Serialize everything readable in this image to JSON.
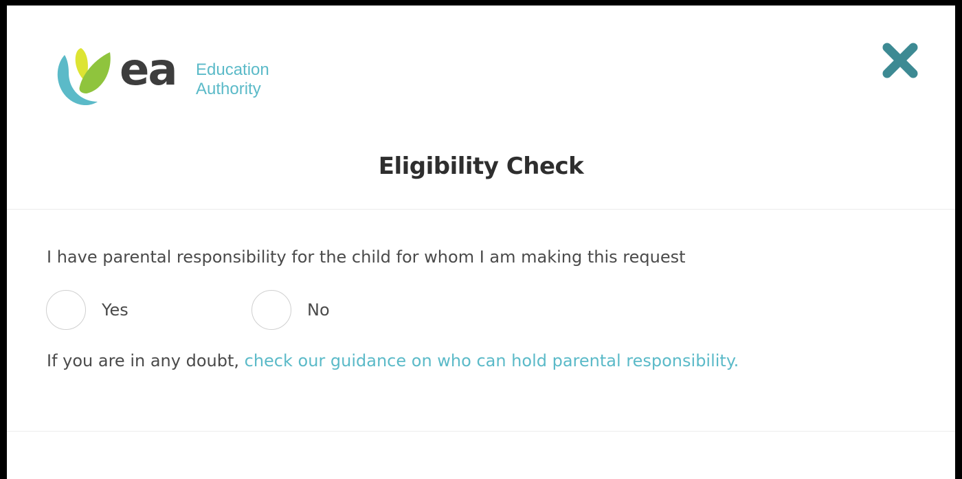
{
  "logo": {
    "wordmark": "ea",
    "line1": "Education",
    "line2": "Authority",
    "colors": {
      "wordmark": "#3d3d3d",
      "tagline": "#5bbac8",
      "leaf_yellow": "#dde433",
      "leaf_green": "#8fc43d",
      "leaf_teal": "#5bbac8"
    }
  },
  "close_button": {
    "icon": "close-icon",
    "color": "#3d8a93"
  },
  "dialog": {
    "title": "Eligibility Check",
    "question": "I have parental responsibility for the child for whom I am making this request",
    "options": [
      {
        "label": "Yes",
        "selected": false
      },
      {
        "label": "No",
        "selected": false
      }
    ],
    "guidance_prefix": "If you are in any doubt, ",
    "guidance_link": "check our guidance on who can hold parental responsibility.",
    "link_color": "#5bbac8"
  }
}
